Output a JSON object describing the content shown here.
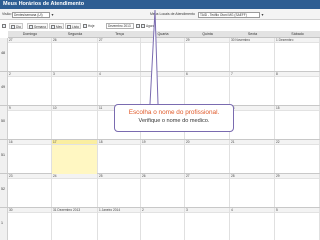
{
  "window": {
    "title": "Meus Horários de Atendimento"
  },
  "toolbar": {
    "view_label": "Visão:",
    "view_value": "Dentes/semana (UI)",
    "agenda_label": "Meus Locais de Atendimento",
    "agenda_value": "TAID - Teófilo Otoni MG (SAEFF)"
  },
  "view_toolbar": {
    "buttons": [
      "Dia",
      "Semana",
      "Mes",
      "Lista",
      "Hoje"
    ],
    "date_value": "Dezembro 2013",
    "refresh_label": "Agora"
  },
  "calendar": {
    "days": [
      "Domingo",
      "Segunda",
      "Terça",
      "Quarta",
      "Quinta",
      "Sexta",
      "Sábado"
    ],
    "weeks": [
      {
        "num": "48",
        "dates": [
          "27",
          "26",
          "27",
          "",
          "29",
          "30 Novembro",
          "1 Dezembro"
        ]
      },
      {
        "num": "49",
        "dates": [
          "2",
          "3",
          "4",
          "",
          "6",
          "7",
          "8"
        ]
      },
      {
        "num": "50",
        "dates": [
          "9",
          "10",
          "11",
          "",
          "13",
          "14",
          "15"
        ]
      },
      {
        "num": "51",
        "dates": [
          "16",
          "17",
          "18",
          "19",
          "20",
          "21",
          "22"
        ]
      },
      {
        "num": "52",
        "dates": [
          "23",
          "24",
          "25",
          "26",
          "27",
          "28",
          "29"
        ]
      },
      {
        "num": "1",
        "dates": [
          "30",
          "31 Dezembro 2013",
          "1 Janeiro 2014",
          "2",
          "3",
          "4",
          "5"
        ]
      }
    ],
    "today": {
      "week": 3,
      "day": 1
    }
  },
  "callout": {
    "line1": "Escolha o nome do profissional.",
    "line2": "Verifique o nome do medico."
  },
  "colors": {
    "title_bar": "#2e5e93",
    "today_bg": "#fff7c2",
    "callout_border": "#7a6bb0",
    "callout_text": "#e05a2a"
  }
}
